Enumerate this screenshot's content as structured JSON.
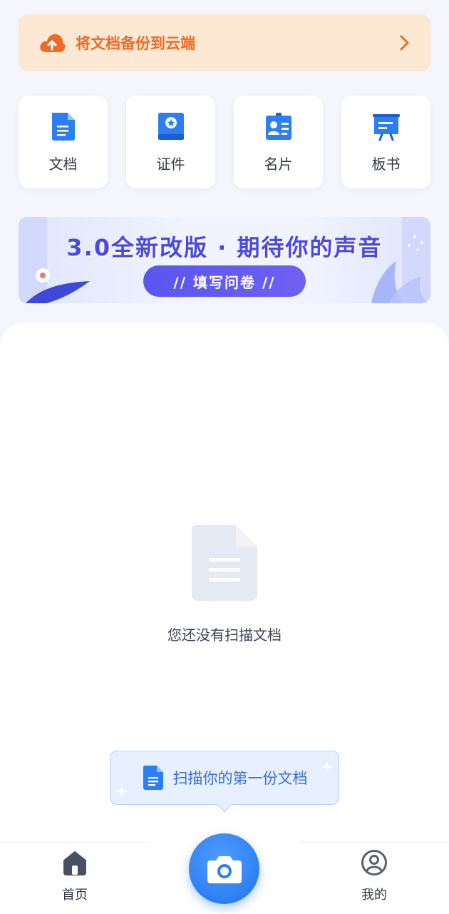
{
  "backup_banner": {
    "text": "将文档备份到云端",
    "icon": "cloud-upload-icon",
    "accent": "#ee6a25",
    "background": "#fde9d3"
  },
  "quick_actions": [
    {
      "label": "文档",
      "icon": "document-icon"
    },
    {
      "label": "证件",
      "icon": "id-book-icon"
    },
    {
      "label": "名片",
      "icon": "business-card-icon"
    },
    {
      "label": "板书",
      "icon": "whiteboard-icon"
    }
  ],
  "survey_banner": {
    "headline": "3.0全新改版 · 期待你的声音",
    "button": "// 填写问卷 //"
  },
  "empty_state": {
    "text": "您还没有扫描文档",
    "icon": "empty-document-icon"
  },
  "tooltip": {
    "text": "扫描你的第一份文档"
  },
  "bottom_nav": {
    "home_label": "首页",
    "mine_label": "我的",
    "camera_icon": "camera-icon"
  },
  "colors": {
    "primary": "#2b7ef6",
    "page_bg": "#f4f6fb"
  }
}
